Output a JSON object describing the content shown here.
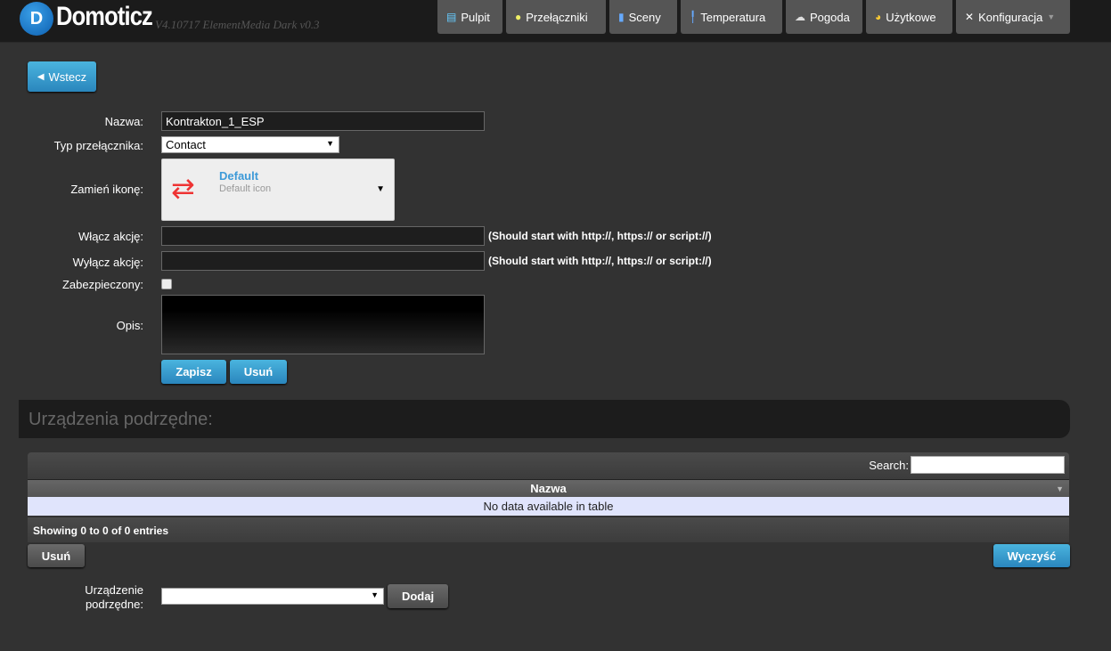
{
  "header": {
    "logo": "Domoticz",
    "version": "V4.10717 ElementMedia Dark v0.3",
    "nav": [
      {
        "label": "Pulpit",
        "icon": "dashboard-icon"
      },
      {
        "label": "Przełączniki",
        "icon": "lightbulb-icon"
      },
      {
        "label": "Sceny",
        "icon": "clapperboard-icon"
      },
      {
        "label": "Temperatura",
        "icon": "thermometer-icon"
      },
      {
        "label": "Pogoda",
        "icon": "weather-icon"
      },
      {
        "label": "Użytkowe",
        "icon": "utility-icon"
      },
      {
        "label": "Konfiguracja",
        "icon": "tools-icon"
      }
    ]
  },
  "back_label": "Wstecz",
  "form": {
    "name_label": "Nazwa:",
    "name_value": "Kontrakton_1_ESP",
    "type_label": "Typ przełącznika:",
    "type_value": "Contact",
    "icon_label": "Zamień ikonę:",
    "icon_title": "Default",
    "icon_desc": "Default icon",
    "on_label": "Włącz akcję:",
    "on_value": "",
    "on_hint": "(Should start with http://, https:// or script://)",
    "off_label": "Wyłącz akcję:",
    "off_value": "",
    "off_hint": "(Should start with http://, https:// or script://)",
    "protected_label": "Zabezpieczony:",
    "protected": false,
    "desc_label": "Opis:",
    "desc_value": "",
    "save": "Zapisz",
    "delete": "Usuń"
  },
  "subdevices": {
    "title": "Urządzenia podrzędne:",
    "search_label": "Search:",
    "search_value": "",
    "column": "Nazwa",
    "empty": "No data available in table",
    "info": "Showing 0 to 0 of 0 entries",
    "delete": "Usuń",
    "clear": "Wyczyść",
    "select_label": "Urządzenie podrzędne:",
    "select_value": "",
    "add": "Dodaj"
  }
}
